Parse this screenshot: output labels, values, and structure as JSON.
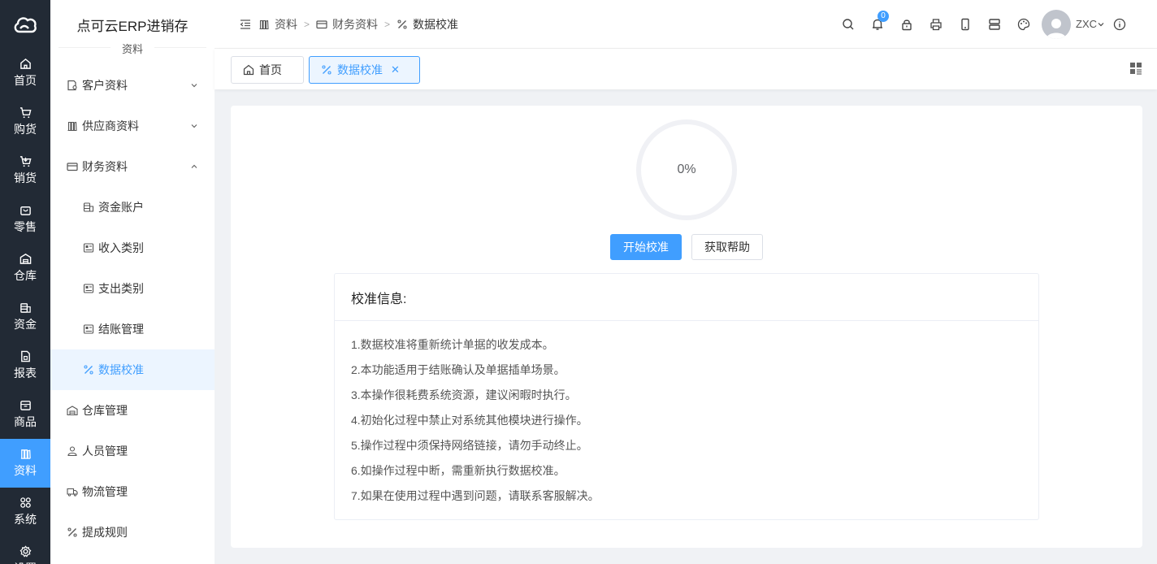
{
  "app": {
    "title": "点可云ERP进销存"
  },
  "rail": {
    "items": [
      {
        "label": "首页",
        "icon": "home-icon",
        "active": false
      },
      {
        "label": "购货",
        "icon": "cart-icon",
        "active": false
      },
      {
        "label": "销货",
        "icon": "cart-out-icon",
        "active": false
      },
      {
        "label": "零售",
        "icon": "bag-icon",
        "active": false
      },
      {
        "label": "仓库",
        "icon": "warehouse-icon",
        "active": false
      },
      {
        "label": "资金",
        "icon": "coins-icon",
        "active": false
      },
      {
        "label": "报表",
        "icon": "report-icon",
        "active": false
      },
      {
        "label": "商品",
        "icon": "box-icon",
        "active": false
      },
      {
        "label": "资料",
        "icon": "books-icon",
        "active": true
      },
      {
        "label": "系统",
        "icon": "apps-icon",
        "active": false
      },
      {
        "label": "设置",
        "icon": "gear-icon",
        "active": false
      }
    ]
  },
  "submenu": {
    "group": "资料",
    "items": [
      {
        "label": "客户资料",
        "icon": "customer-icon",
        "expandable": true,
        "expanded": false
      },
      {
        "label": "供应商资料",
        "icon": "books-icon",
        "expandable": true,
        "expanded": false
      },
      {
        "label": "财务资料",
        "icon": "card-icon",
        "expandable": true,
        "expanded": true
      },
      {
        "label": "资金账户",
        "icon": "coins-icon",
        "child": true
      },
      {
        "label": "收入类别",
        "icon": "category-icon",
        "child": true
      },
      {
        "label": "支出类别",
        "icon": "category-icon",
        "child": true
      },
      {
        "label": "结账管理",
        "icon": "category-icon",
        "child": true
      },
      {
        "label": "数据校准",
        "icon": "percent-icon",
        "child": true,
        "active": true
      },
      {
        "label": "仓库管理",
        "icon": "warehouse-icon"
      },
      {
        "label": "人员管理",
        "icon": "user-icon"
      },
      {
        "label": "物流管理",
        "icon": "truck-icon"
      },
      {
        "label": "提成规则",
        "icon": "percent-icon"
      }
    ]
  },
  "breadcrumb": [
    {
      "label": "资料",
      "icon": "books-icon"
    },
    {
      "label": "财务资料",
      "icon": "card-icon"
    },
    {
      "label": "数据校准",
      "icon": "percent-icon"
    }
  ],
  "header": {
    "notification_count": "0",
    "username": "ZXC"
  },
  "tabs": [
    {
      "label": "首页",
      "icon": "home-icon",
      "active": false
    },
    {
      "label": "数据校准",
      "icon": "percent-icon",
      "active": true,
      "closable": true
    }
  ],
  "calibration": {
    "progress_text": "0%",
    "progress_percent": 0,
    "start_label": "开始校准",
    "help_label": "获取帮助",
    "info_title": "校准信息:",
    "info_lines": [
      "1.数据校准将重新统计单据的收发成本。",
      "2.本功能适用于结账确认及单据插单场景。",
      "3.本操作很耗费系统资源，建议闲暇时执行。",
      "4.初始化过程中禁止对系统其他模块进行操作。",
      "5.操作过程中须保持网络链接，请勿手动终止。",
      "6.如操作过程中断，需重新执行数据校准。",
      "7.如果在使用过程中遇到问题，请联系客服解决。"
    ]
  },
  "colors": {
    "accent": "#409eff",
    "rail_bg": "#222a35",
    "active_bg": "#ecf5ff"
  }
}
